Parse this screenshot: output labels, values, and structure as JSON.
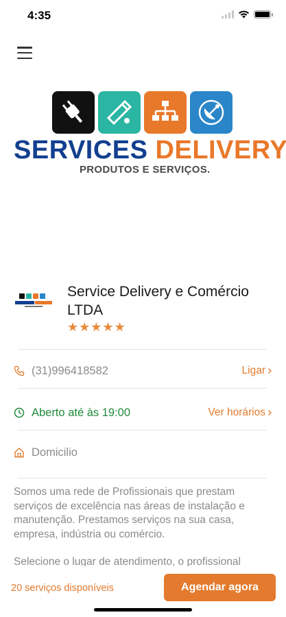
{
  "status_bar": {
    "time": "4:35"
  },
  "logo": {
    "word1": "SERVICES",
    "word2": "DELIVERY",
    "subtitle": "PRODUTOS E SERVIÇOS.",
    "tiles": [
      {
        "icon": "plug-icon",
        "color": "#111111"
      },
      {
        "icon": "pipe-wrench-icon",
        "color": "#2bb5a3"
      },
      {
        "icon": "network-icon",
        "color": "#e8782a"
      },
      {
        "icon": "satellite-dish-icon",
        "color": "#2a86c9"
      }
    ]
  },
  "business": {
    "name": "Service Delivery e Comércio LTDA",
    "stars": "★★★★★",
    "rating": 5
  },
  "contact": {
    "phone": "(31)996418582",
    "call_label": "Ligar",
    "hours": "Aberto até às 19:00",
    "hours_link": "Ver horários",
    "location": "Domicilio"
  },
  "description": {
    "p1": "Somos uma rede de Profissionais que prestam serviços de excelência nas áreas de instalação e manutenção. Prestamos serviços na sua casa, empresa, indústria ou comércio.",
    "p2": "Selecione o lugar de atendimento, o profissional"
  },
  "footer": {
    "services_count": "20 serviços disponíveis",
    "cta": "Agendar agora"
  },
  "colors": {
    "accent": "#e47a2d",
    "brand_blue": "#123f8f",
    "open_green": "#1f8a3a"
  }
}
